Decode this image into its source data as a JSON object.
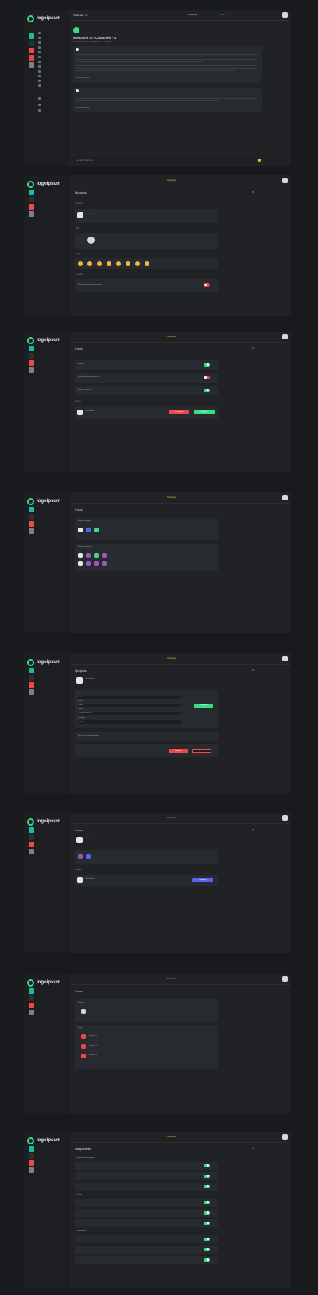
{
  "app": {
    "name": "logoipsum"
  },
  "colors": {
    "accent": "#3ddc84",
    "danger": "#f04747",
    "warning": "#f2b347",
    "blurple": "#5865f2",
    "teal": "#1abc9c"
  },
  "topbar": {
    "premium": "Премиум",
    "online": "24 / 7"
  },
  "panel1": {
    "channel": "Channels - 1",
    "welcome_title": "Welcome to #Channels - 1",
    "welcome_sub": "This is the start of the #Channels - 1 channel.",
    "input_placeholder": "Message #Channels - 1"
  },
  "panel2": {
    "title": "Профиль",
    "section": "Профиль",
    "user": "Charlie Bee",
    "label_rows": [
      "Фон",
      "Тема",
      "Смайлы"
    ],
    "toggle_label": "Включить модерацию группы"
  },
  "panel3": {
    "title": "Стиль",
    "rows": [
      "Бейджи",
      "Отображение активности",
      "Выпуск событий"
    ],
    "sub_title": "Доступ",
    "user": "Charlie Bee",
    "btn_red": "Отклонить",
    "btn_green": "Принять"
  },
  "panel4": {
    "title": "Стиль",
    "block1": "Бейджи сервера",
    "block2": "Бейджи профиля"
  },
  "panel5": {
    "title": "Профиль",
    "user": "Charlie Bee",
    "fields": [
      "Имя",
      "Почта",
      "Пароль",
      "Телефон"
    ],
    "values": [
      "Charlie",
      "Bee",
      "charlie@bee.io",
      "•••••••"
    ],
    "save": "Сохранить",
    "row1": "Включить двухфакторную",
    "row2": "Удалить аккаунт",
    "danger_btn": "Удалить",
    "cancel_btn": "Отмена"
  },
  "panel6": {
    "title": "Стиль",
    "sub_title": "Бейджи",
    "user": "Charlie Bee",
    "btn": "Выбрать"
  },
  "panel7": {
    "title": "Стиль",
    "card1": "Уровень",
    "card2": "Ряды",
    "rows": [
      "Уровень 1",
      "Уровень 2",
      "Уровень 3"
    ]
  },
  "panel8": {
    "title": "Уведомления",
    "groups": [
      "Уведомления сервера",
      "Отзыв",
      "Упоминания"
    ]
  }
}
